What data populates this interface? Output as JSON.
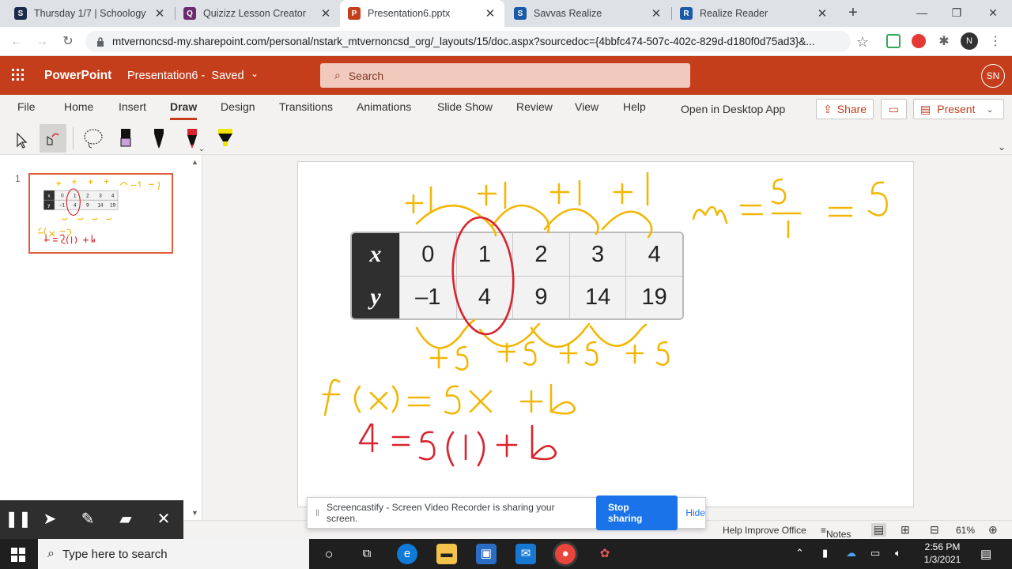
{
  "browser": {
    "tabs": [
      {
        "title": "Thursday 1/7 | Schoology",
        "favicon": "schoology-icon",
        "color": "#1b2b4a",
        "active": false
      },
      {
        "title": "Quizizz Lesson Creator",
        "favicon": "quizizz-icon",
        "color": "#6b2a6e",
        "active": false
      },
      {
        "title": "Presentation6.pptx",
        "favicon": "powerpoint-icon",
        "color": "#c43e1c",
        "active": true
      },
      {
        "title": "Savvas Realize",
        "favicon": "savvas-icon",
        "color": "#1a5aa6",
        "active": false
      },
      {
        "title": "Realize Reader",
        "favicon": "realize-icon",
        "color": "#1a5aa6",
        "active": false
      }
    ],
    "url": "mtvernoncsd-my.sharepoint.com/personal/nstark_mtvernoncsd_org/_layouts/15/doc.aspx?sourcedoc={4bbfc474-507c-402c-829d-d180f0d75ad3}&...",
    "profile_initial": "N"
  },
  "app": {
    "name": "PowerPoint",
    "doc_title": "Presentation6",
    "save_status": "Saved",
    "search_placeholder": "Search",
    "user_initials": "SN",
    "accent": "#c43e1c"
  },
  "ribbon": {
    "tabs": [
      "File",
      "Home",
      "Insert",
      "Draw",
      "Design",
      "Transitions",
      "Animations",
      "Slide Show",
      "Review",
      "View",
      "Help"
    ],
    "selected": "Draw",
    "open_desktop": "Open in Desktop App",
    "share": "Share",
    "present": "Present"
  },
  "thumbnails": [
    {
      "number": "1"
    }
  ],
  "slide": {
    "table": {
      "x_label": "x",
      "y_label": "y",
      "x_values": [
        "0",
        "1",
        "2",
        "3",
        "4"
      ],
      "y_values": [
        "–1",
        "4",
        "9",
        "14",
        "19"
      ]
    },
    "ink_colors": {
      "yellow": "#f2b705",
      "red": "#d9232d"
    }
  },
  "statusbar": {
    "help_improve": "Help Improve Office",
    "notes": "Notes",
    "zoom": "61%"
  },
  "screencastify": {
    "message": "Screencastify - Screen Video Recorder is sharing your screen.",
    "stop": "Stop sharing",
    "hide": "Hide"
  },
  "taskbar": {
    "search_placeholder": "Type here to search",
    "time": "2:56 PM",
    "date": "1/3/2021"
  }
}
